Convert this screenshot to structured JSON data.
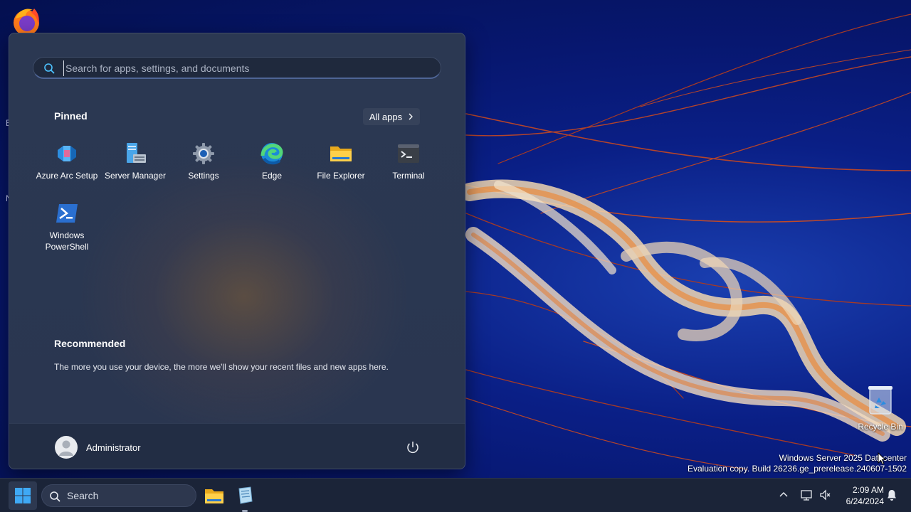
{
  "desktop": {
    "edge_labels": [
      "E",
      "N"
    ],
    "recycle_bin_label": "Recycle Bin",
    "watermark_line1": "Windows Server 2025 Datacenter",
    "watermark_line2": "Evaluation copy. Build 26236.ge_prerelease.240607-1502"
  },
  "start_menu": {
    "search_placeholder": "Search for apps, settings, and documents",
    "pinned_title": "Pinned",
    "all_apps_label": "All apps",
    "pinned_apps": [
      {
        "label": "Azure Arc Setup",
        "icon": "azure-arc-icon"
      },
      {
        "label": "Server Manager",
        "icon": "server-manager-icon"
      },
      {
        "label": "Settings",
        "icon": "gear-icon"
      },
      {
        "label": "Edge",
        "icon": "edge-icon"
      },
      {
        "label": "File Explorer",
        "icon": "folder-icon"
      },
      {
        "label": "Terminal",
        "icon": "terminal-icon"
      },
      {
        "label": "Windows PowerShell",
        "icon": "powershell-icon"
      }
    ],
    "recommended_title": "Recommended",
    "recommended_text": "The more you use your device, the more we'll show your recent files and new apps here.",
    "user_name": "Administrator"
  },
  "taskbar": {
    "search_label": "Search",
    "time": "2:09 AM",
    "date": "6/24/2024"
  },
  "colors": {
    "accent": "#4cc2ff",
    "menu_bg": "#2b3852",
    "taskbar_bg": "#1b2438"
  }
}
